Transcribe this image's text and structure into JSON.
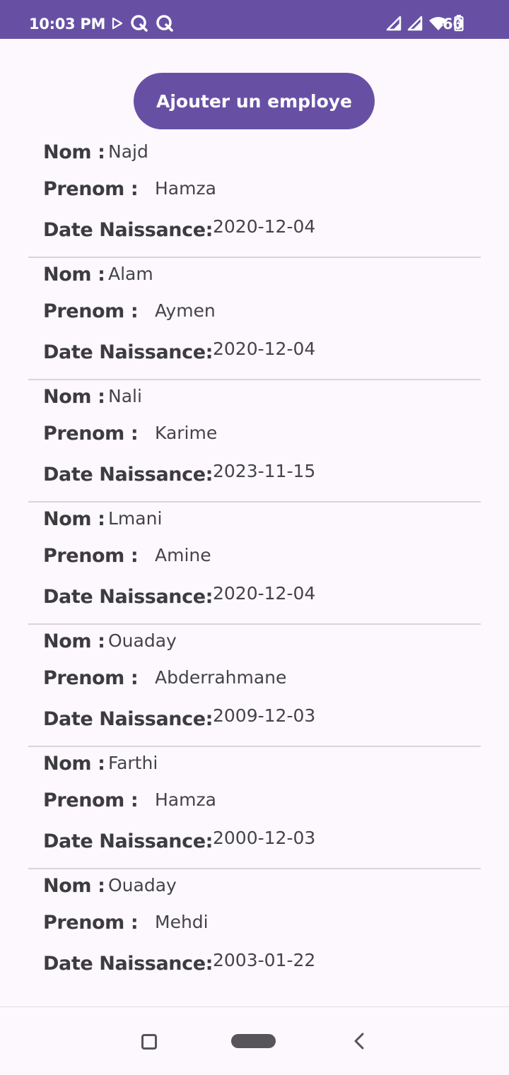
{
  "theme": {
    "accent": "#6750a4"
  },
  "status_bar": {
    "time": "10:03 PM",
    "battery": "60"
  },
  "actions": {
    "add_employee_label": "Ajouter un employe"
  },
  "labels": {
    "nom": "Nom :",
    "prenom": "Prenom :",
    "date": "Date Naissance:"
  },
  "employees": [
    {
      "nom": "Najd",
      "prenom": "Hamza",
      "date": "2020-12-04"
    },
    {
      "nom": "Alam",
      "prenom": "Aymen",
      "date": "2020-12-04"
    },
    {
      "nom": "Nali",
      "prenom": "Karime",
      "date": "2023-11-15"
    },
    {
      "nom": "Lmani",
      "prenom": "Amine",
      "date": "2020-12-04"
    },
    {
      "nom": "Ouaday",
      "prenom": "Abderrahmane",
      "date": "2009-12-03"
    },
    {
      "nom": "Farthi",
      "prenom": "Hamza",
      "date": "2000-12-03"
    },
    {
      "nom": "Ouaday",
      "prenom": "Mehdi",
      "date": "2003-01-22"
    }
  ]
}
